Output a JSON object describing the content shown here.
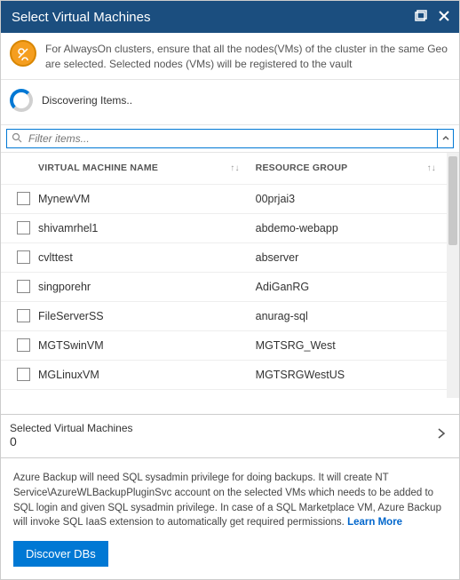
{
  "header": {
    "title": "Select Virtual Machines"
  },
  "banner": {
    "text": "For AlwaysOn clusters, ensure that all the nodes(VMs) of the cluster in the same Geo are selected. Selected nodes (VMs) will be registered to the vault"
  },
  "discovering": {
    "text": "Discovering Items.."
  },
  "filter": {
    "placeholder": "Filter items..."
  },
  "columns": {
    "vm": "VIRTUAL MACHINE NAME",
    "rg": "RESOURCE GROUP"
  },
  "rows": [
    {
      "vm": "MynewVM",
      "rg": "00prjai3"
    },
    {
      "vm": "shivamrhel1",
      "rg": "abdemo-webapp"
    },
    {
      "vm": "cvlttest",
      "rg": "abserver"
    },
    {
      "vm": "singporehr",
      "rg": "AdiGanRG"
    },
    {
      "vm": "FileServerSS",
      "rg": "anurag-sql"
    },
    {
      "vm": "MGTSwinVM",
      "rg": "MGTSRG_West"
    },
    {
      "vm": "MGLinuxVM",
      "rg": "MGTSRGWestUS"
    }
  ],
  "summary": {
    "label": "Selected Virtual Machines",
    "count": "0"
  },
  "footer": {
    "text": "Azure Backup will need SQL sysadmin privilege for doing backups. It will create NT Service\\AzureWLBackupPluginSvc account on the selected VMs which needs to be added to SQL login and given SQL sysadmin privilege. In case of a SQL Marketplace VM, Azure Backup will invoke SQL IaaS extension to automatically get required permissions. ",
    "learn_more": "Learn More",
    "button": "Discover DBs"
  }
}
